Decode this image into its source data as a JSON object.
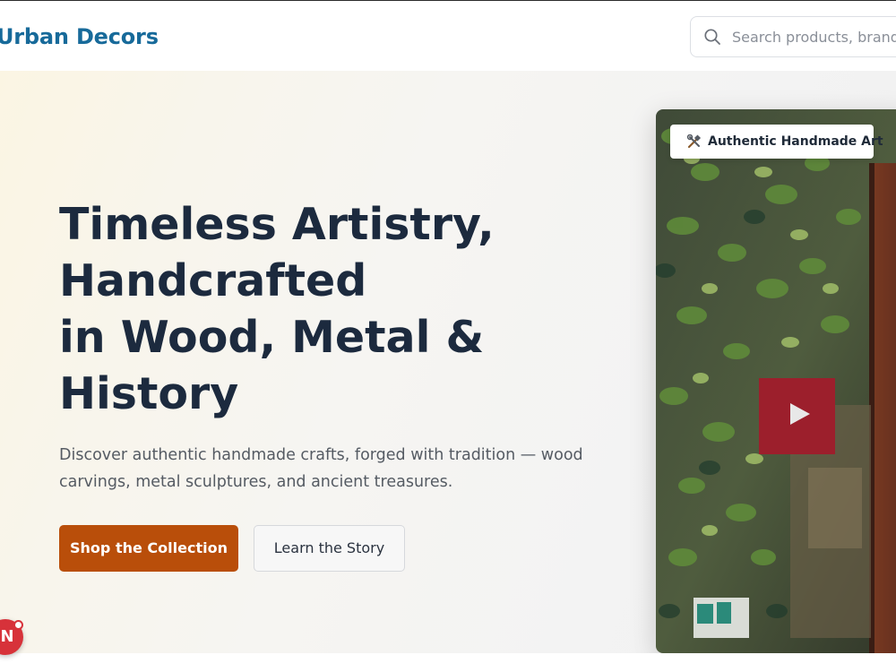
{
  "header": {
    "brand": "Urban Decors",
    "search": {
      "placeholder": "Search products, brands",
      "icon": "search-icon"
    }
  },
  "hero": {
    "title_lines": [
      "Timeless Artistry,",
      "Handcrafted",
      "in Wood, Metal &",
      "History"
    ],
    "description_lines": [
      "Discover authentic handmade crafts, forged with tradition — wood",
      "carvings, metal sculptures, and ancient treasures."
    ],
    "primary_button": "Shop the Collection",
    "secondary_button": "Learn the Story",
    "badge": {
      "icon": "tools-icon",
      "label": "Authentic Handmade Art"
    },
    "image": {
      "subject": "ivy-covered-wall-icon"
    }
  },
  "widget": {
    "label": "N"
  },
  "colors": {
    "brand": "#176a9a",
    "primary_button": "#b94e0a",
    "title": "#1c2a3e",
    "widget": "#d7323a"
  }
}
